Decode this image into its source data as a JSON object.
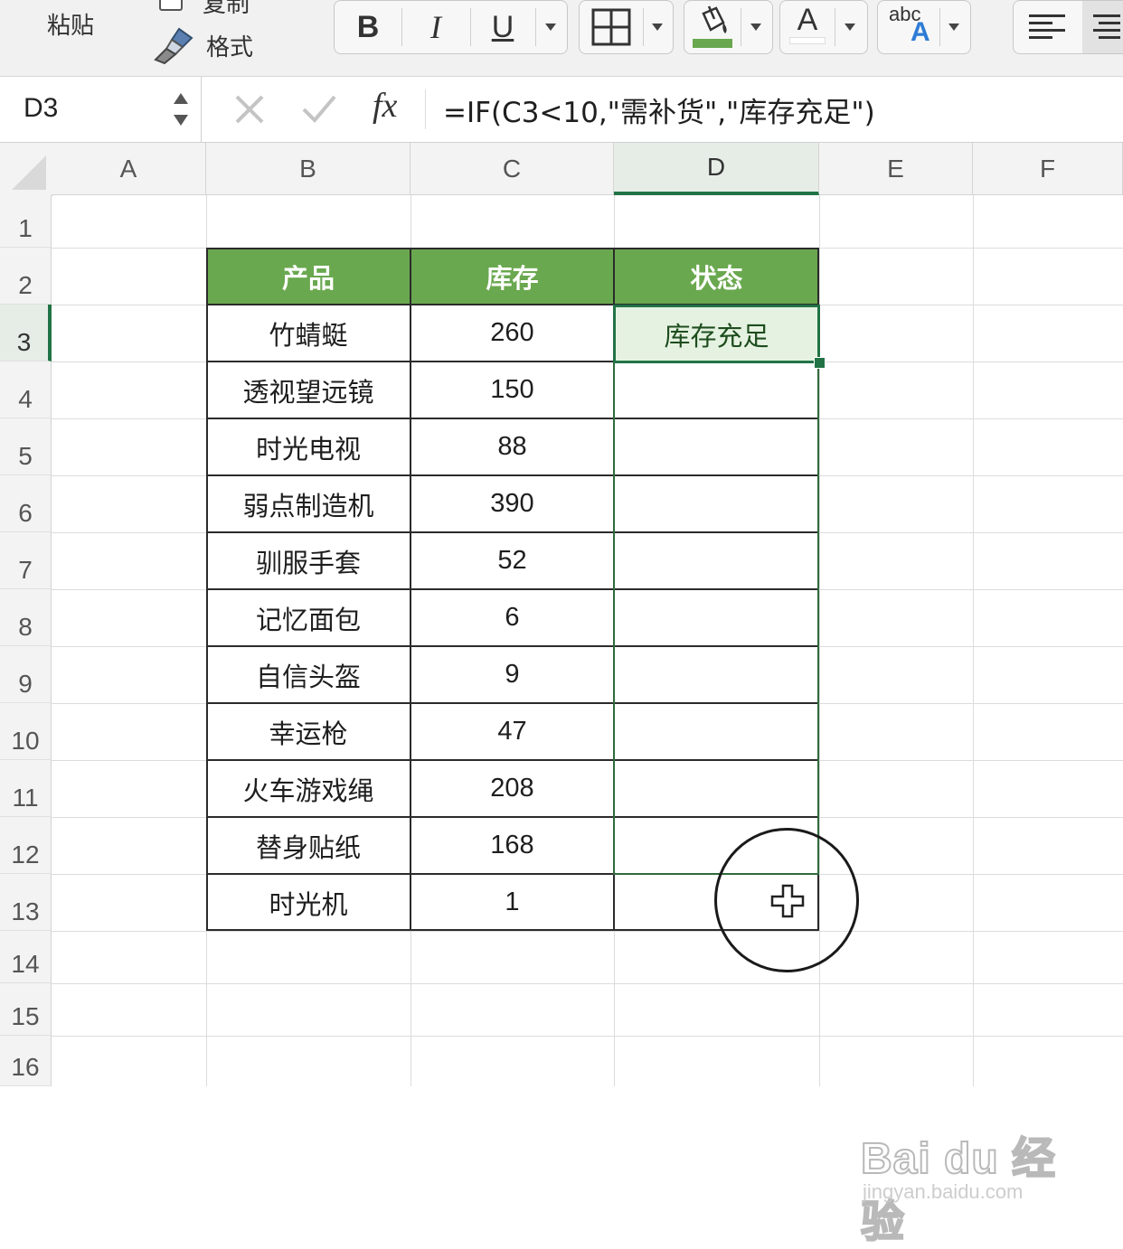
{
  "ribbon": {
    "paste_label": "粘贴",
    "copy_label": "复制",
    "format_painter_label": "格式",
    "bold_label": "B",
    "italic_label": "I",
    "underline_label": "U",
    "font_color_letter": "A",
    "phonetic_small": "abc",
    "phonetic_big": "A",
    "fill_color": "#6aa84f",
    "font_color": "#ffffff",
    "icons": [
      "format-painter-icon",
      "borders-icon",
      "fill-bucket-icon",
      "align-left-icon",
      "align-center-icon"
    ]
  },
  "formula_bar": {
    "name_box": "D3",
    "fx_label": "fx",
    "formula": "=IF(C3<10,\"需补货\",\"库存充足\")"
  },
  "columns": [
    "A",
    "B",
    "C",
    "D",
    "E",
    "F"
  ],
  "active_column": "D",
  "rows": [
    "1",
    "2",
    "3",
    "4",
    "5",
    "6",
    "7",
    "8",
    "9",
    "10",
    "11",
    "12",
    "13",
    "14",
    "15",
    "16"
  ],
  "active_row": "3",
  "table": {
    "headers": [
      "产品",
      "库存",
      "状态"
    ],
    "header_color": "#6aa84f",
    "rows": [
      {
        "product": "竹蜻蜓",
        "stock": "260",
        "status": "库存充足"
      },
      {
        "product": "透视望远镜",
        "stock": "150",
        "status": ""
      },
      {
        "product": "时光电视",
        "stock": "88",
        "status": ""
      },
      {
        "product": "弱点制造机",
        "stock": "390",
        "status": ""
      },
      {
        "product": "驯服手套",
        "stock": "52",
        "status": ""
      },
      {
        "product": "记忆面包",
        "stock": "6",
        "status": ""
      },
      {
        "product": "自信头盔",
        "stock": "9",
        "status": ""
      },
      {
        "product": "幸运枪",
        "stock": "47",
        "status": ""
      },
      {
        "product": "火车游戏绳",
        "stock": "208",
        "status": ""
      },
      {
        "product": "替身贴纸",
        "stock": "168",
        "status": ""
      },
      {
        "product": "时光机",
        "stock": "1",
        "status": ""
      }
    ]
  },
  "selection_color": "#217346",
  "watermark": {
    "brand": "Bai du 经验",
    "url": "jingyan.baidu.com"
  }
}
